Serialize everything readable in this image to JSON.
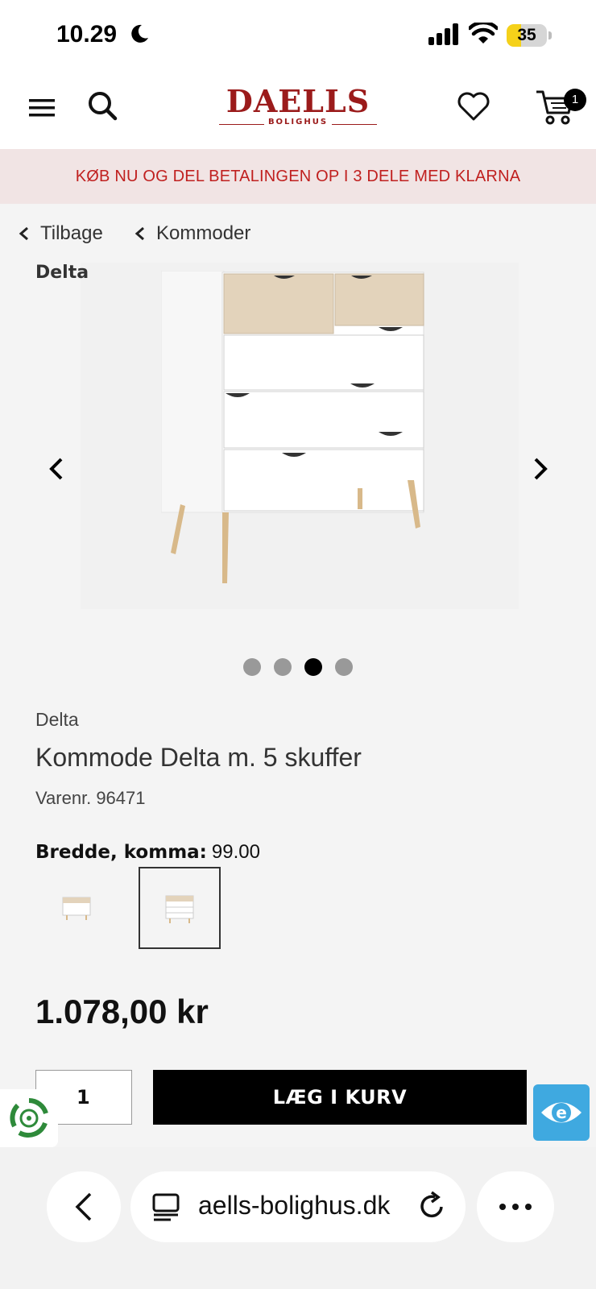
{
  "status_bar": {
    "time": "10.29",
    "battery_level": "35",
    "icons": [
      "moon-icon",
      "signal-icon",
      "wifi-icon",
      "battery-icon"
    ]
  },
  "header": {
    "logo_main": "DAELLS",
    "logo_sub": "BOLIGHUS",
    "cart_count": "1",
    "icons": [
      "menu-icon",
      "search-icon",
      "heart-icon",
      "cart-icon"
    ],
    "brand_color": "#9b1b1b"
  },
  "promo": {
    "text": "KØB NU OG DEL BETALINGEN OP I 3 DELE MED KLARNA",
    "color": "#c0201f",
    "background": "#f1e4e4"
  },
  "breadcrumbs": {
    "back_label": "Tilbage",
    "category_label": "Kommoder"
  },
  "gallery": {
    "overlay_brand": "Delta",
    "dot_count": 4,
    "active_index": 2
  },
  "product": {
    "brand": "Delta",
    "title": "Kommode Delta m. 5 skuffer",
    "sku_label": "Varenr.",
    "sku_value": "96471",
    "variant_label": "Bredde, komma:",
    "variant_value": "99.00",
    "price": "1.078,00 kr",
    "quantity": "1",
    "add_to_cart_label": "LÆG I KURV"
  },
  "browser": {
    "url_text": "aells-bolighus.dk",
    "icons": [
      "back-icon",
      "tabs-icon",
      "reload-icon",
      "more-icon"
    ]
  }
}
